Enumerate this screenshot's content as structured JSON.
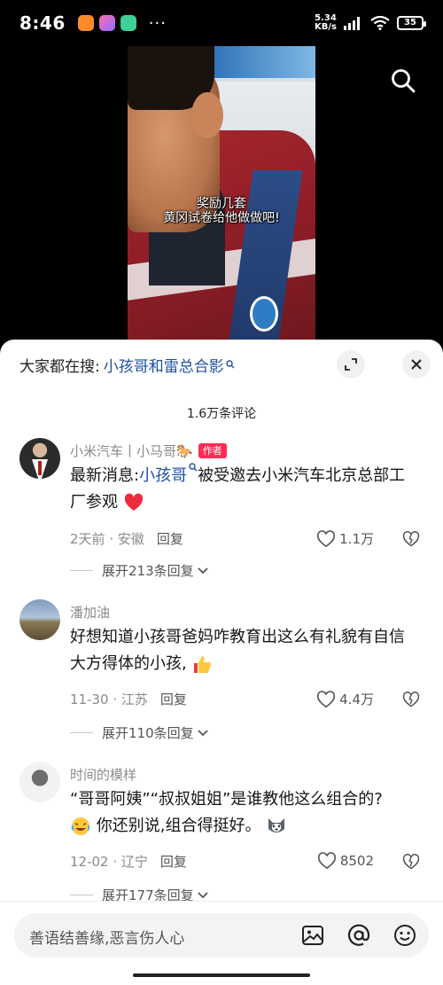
{
  "status_bar": {
    "time": "8:46",
    "more": "···",
    "net_speed_value": "5.34",
    "net_speed_unit": "KB/s",
    "battery": "35"
  },
  "video": {
    "subtitle_line1": "奖励几套",
    "subtitle_line2": "黄冈试卷给他做做吧!"
  },
  "sheet": {
    "trending_label": "大家都在搜:",
    "trending_query": "小孩哥和雷总合影",
    "comment_count": "1.6万条评论"
  },
  "comments": [
    {
      "name": "小米汽车丨小马哥🐎",
      "author_tag": "作者",
      "text_prefix": "最新消息:",
      "text_link": "小孩哥",
      "text_suffix": "被受邀去小米汽车北京总部工厂参观",
      "emoji": "red-heart",
      "date": "2天前",
      "location": "安徽",
      "reply": "回复",
      "likes": "1.1万",
      "expand": "展开213条回复"
    },
    {
      "name": "潘加油",
      "text": "好想知道小孩哥爸妈咋教育出这么有礼貌有自信大方得体的小孩,",
      "emoji": "thumbs-up",
      "date": "11-30",
      "location": "江苏",
      "reply": "回复",
      "likes": "4.4万",
      "expand": "展开110条回复"
    },
    {
      "name": "时间的模样",
      "text_line1": "“哥哥阿姨”“叔叔姐姐”是谁教他这么组合的?",
      "text_line2": "你还别说,组合得挺好。",
      "emoji_lead": "laughing-crying",
      "emoji_tail": "husky-dog",
      "date": "12-02",
      "location": "辽宁",
      "reply": "回复",
      "likes": "8502",
      "expand": "展开177条回复"
    }
  ],
  "input": {
    "placeholder": "善语结善缘,恶言伤人心"
  },
  "colors": {
    "link": "#1f4fa8",
    "author_tag": "#fe2c55",
    "muted": "#8a8a8a"
  }
}
